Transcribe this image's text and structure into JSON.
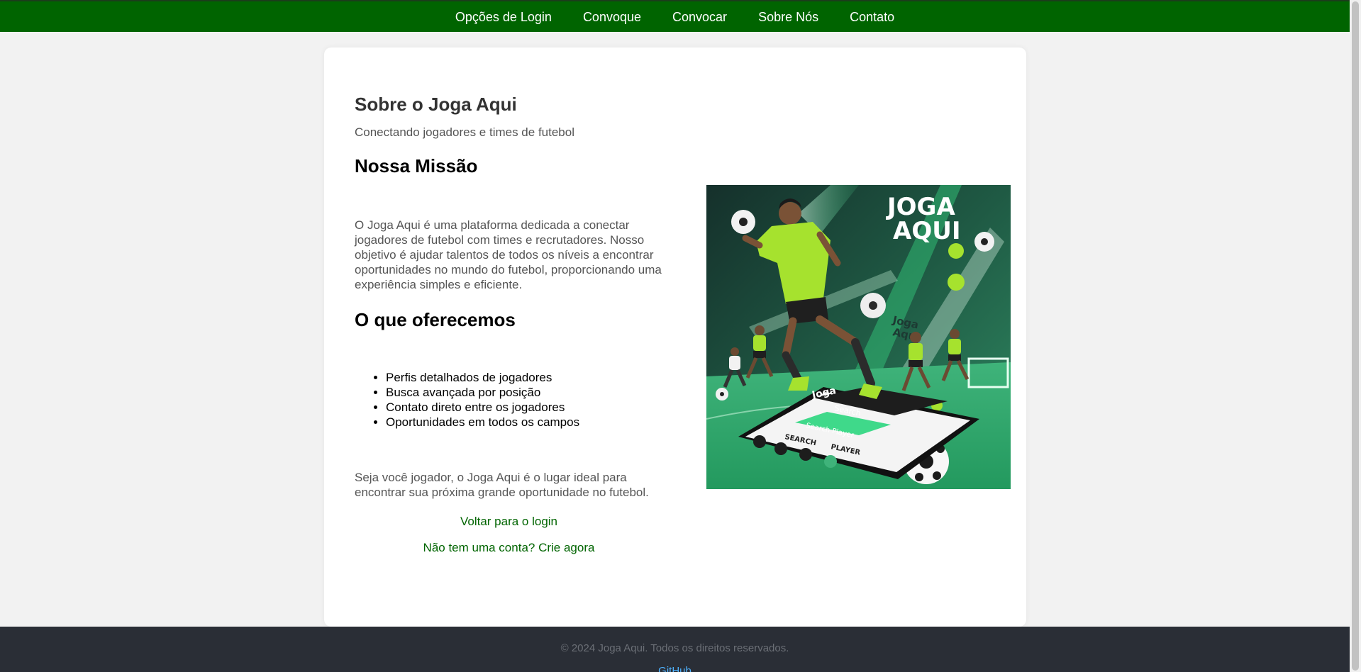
{
  "nav": {
    "items": [
      {
        "label": "Opções de Login"
      },
      {
        "label": "Convoque"
      },
      {
        "label": "Convocar"
      },
      {
        "label": "Sobre Nós"
      },
      {
        "label": "Contato"
      }
    ]
  },
  "about": {
    "title": "Sobre o Joga Aqui",
    "subtitle": "Conectando jogadores e times de futebol",
    "mission_heading": "Nossa Missão",
    "mission_text": "O Joga Aqui é uma plataforma dedicada a conectar jogadores de futebol com times e recrutadores. Nosso objetivo é ajudar talentos de todos os níveis a encontrar oportunidades no mundo do futebol, proporcionando uma experiência simples e eficiente.",
    "offer_heading": "O que oferecemos",
    "offers": [
      "Perfis detalhados de jogadores",
      "Busca avançada por posição",
      "Contato direto entre os jogadores",
      "Oportunidades em todos os campos"
    ],
    "closing_text": "Seja você jogador, o Joga Aqui é o lugar ideal para encontrar sua próxima grande oportunidade no futebol.",
    "back_to_login": "Voltar para o login",
    "create_account": "Não tem uma conta? Crie agora"
  },
  "hero": {
    "brand_line1": "JOGA",
    "brand_line2": "AQUI",
    "small_logo_1": "Joga",
    "small_logo_2": "Aqui",
    "phone_app_name": "Joga",
    "phone_search": "Search",
    "phone_search_bar": "Search Player",
    "phone_label_search": "SEARCH",
    "phone_label_player": "PLAYER"
  },
  "footer": {
    "copyright": "© 2024 Joga Aqui. Todos os direitos reservados.",
    "github": "GitHub"
  },
  "colors": {
    "nav_bg": "#006400",
    "link": "#006400",
    "footer_bg": "#2a2e36",
    "hero_bg": "#1d3a33",
    "jersey": "#a6e22e"
  }
}
